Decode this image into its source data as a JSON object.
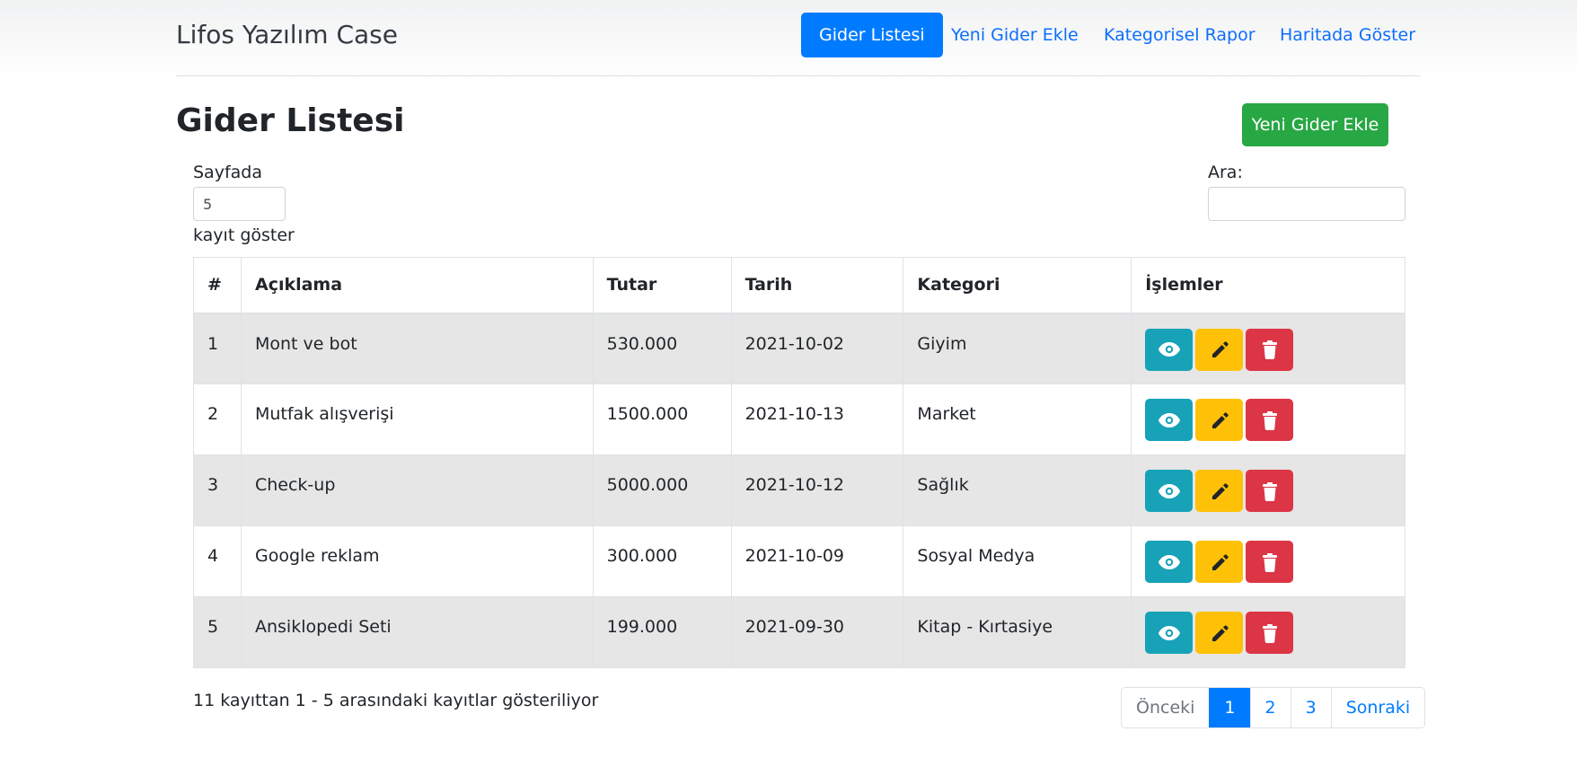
{
  "navbar": {
    "brand": "Lifos Yazılım Case",
    "links": [
      {
        "label": "Gider Listesi",
        "active": true
      },
      {
        "label": "Yeni Gider Ekle",
        "active": false
      },
      {
        "label": "Kategorisel Rapor",
        "active": false
      },
      {
        "label": "Haritada Göster",
        "active": false
      }
    ]
  },
  "page": {
    "title": "Gider Listesi",
    "add_button_label": "Yeni Gider Ekle"
  },
  "length_control": {
    "label_before": "Sayfada",
    "value": "5",
    "label_after": "kayıt göster"
  },
  "search": {
    "label": "Ara:",
    "value": ""
  },
  "table": {
    "headers": [
      "#",
      "Açıklama",
      "Tutar",
      "Tarih",
      "Kategori",
      "İşlemler"
    ],
    "rows": [
      {
        "no": "1",
        "description": "Mont ve bot",
        "amount": "530.000",
        "date": "2021-10-02",
        "category": "Giyim"
      },
      {
        "no": "2",
        "description": "Mutfak alışverişi",
        "amount": "1500.000",
        "date": "2021-10-13",
        "category": "Market"
      },
      {
        "no": "3",
        "description": "Check-up",
        "amount": "5000.000",
        "date": "2021-10-12",
        "category": "Sağlık"
      },
      {
        "no": "4",
        "description": "Google reklam",
        "amount": "300.000",
        "date": "2021-10-09",
        "category": "Sosyal Medya"
      },
      {
        "no": "5",
        "description": "Ansiklopedi Seti",
        "amount": "199.000",
        "date": "2021-09-30",
        "category": "Kitap - Kırtasiye"
      }
    ],
    "action_icons": [
      "eye-icon",
      "pencil-icon",
      "trash-icon"
    ]
  },
  "footer": {
    "info": "11 kayıttan 1 - 5 arasındaki kayıtlar gösteriliyor",
    "pagination": {
      "previous": "Önceki",
      "pages": [
        "1",
        "2",
        "3"
      ],
      "current": "1",
      "next": "Sonraki"
    }
  },
  "colors": {
    "primary": "#007bff",
    "success": "#28a745",
    "info": "#17a2b8",
    "warning": "#ffc107",
    "danger": "#dc3545"
  }
}
